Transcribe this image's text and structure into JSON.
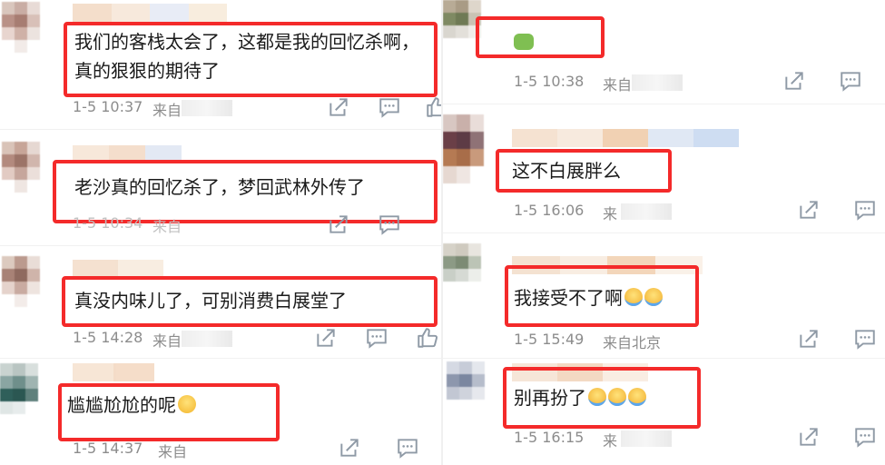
{
  "colors": {
    "highlight": "#f42a2a",
    "meta_text": "#8c8c8c",
    "comment_text": "#1a1a1a",
    "icon": "#8f9aa6"
  },
  "left_comments": [
    {
      "text_line1": "我们的客栈太会了，这都是我的回忆杀啊，",
      "text_line2": "真的狠狠的期待了",
      "date": "1-5 10:37",
      "from": "来自"
    },
    {
      "text_line1": "老沙真的回忆杀了，梦回武林外传了",
      "date": "1-5 10:34",
      "from": "来自"
    },
    {
      "text_line1": "真没内味儿了，可别消费白展堂了",
      "date": "1-5 14:28",
      "from": "来自"
    },
    {
      "text_line1": "尴尴尬尬的呢",
      "emoji": "smile-emoji-icon",
      "date": "1-5 14:37",
      "from": "来自"
    }
  ],
  "right_comments": [
    {
      "emoji": "frog-emoji-icon",
      "date": "1-5 10:38",
      "from": "来自"
    },
    {
      "text": "这不白展胖么",
      "date": "1-5 16:06",
      "from": "来"
    },
    {
      "text": "我接受不了啊",
      "emoji": "crying-emoji-icon",
      "date": "1-5 15:49",
      "from": "来自北京"
    },
    {
      "text": "别再扮了",
      "emoji": "crying-emoji-icon",
      "date": "1-5 16:15",
      "from": "来"
    }
  ],
  "icons": {
    "share": "share-icon",
    "comment": "comment-icon",
    "like": "like-icon"
  }
}
